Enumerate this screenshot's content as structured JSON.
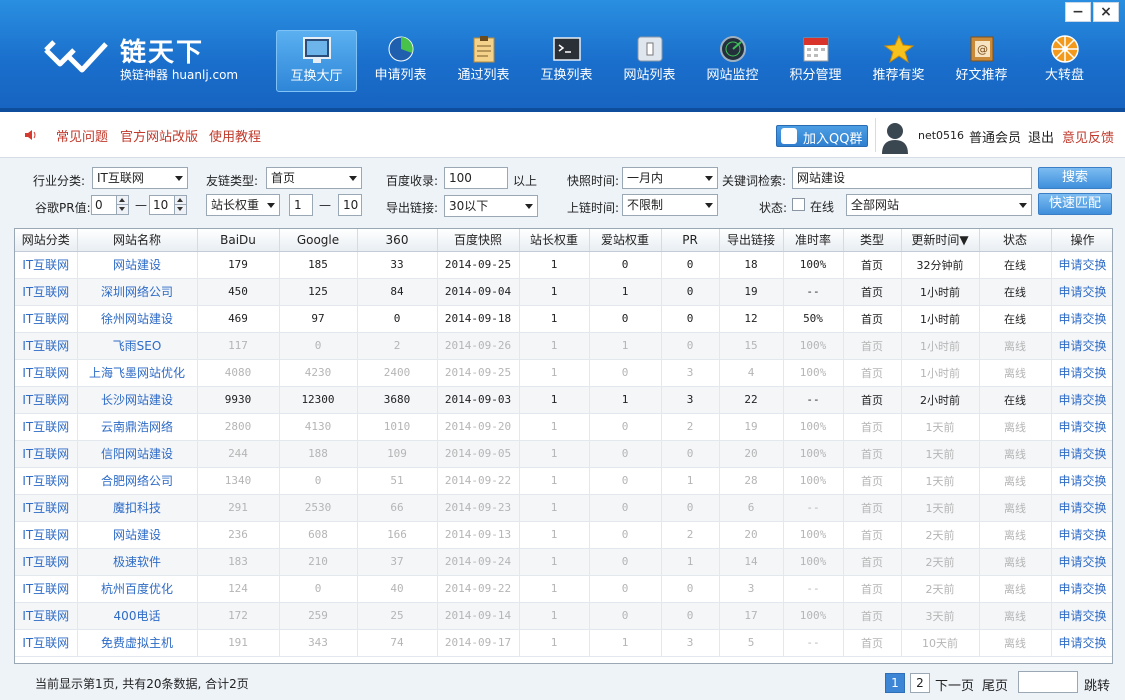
{
  "app": {
    "logo_title": "链天下",
    "logo_sub": "换链神器 huanlj.com"
  },
  "nav": [
    {
      "label": "互换大厅",
      "icon": "monitor-icon",
      "active": true
    },
    {
      "label": "申请列表",
      "icon": "pie-chart-icon"
    },
    {
      "label": "通过列表",
      "icon": "clipboard-icon"
    },
    {
      "label": "互换列表",
      "icon": "console-icon"
    },
    {
      "label": "网站列表",
      "icon": "window-icon"
    },
    {
      "label": "网站监控",
      "icon": "radar-icon"
    },
    {
      "label": "积分管理",
      "icon": "calendar-icon"
    },
    {
      "label": "推荐有奖",
      "icon": "star-icon"
    },
    {
      "label": "好文推荐",
      "icon": "email-book-icon"
    },
    {
      "label": "大转盘",
      "icon": "wheel-icon"
    }
  ],
  "window": {
    "minimize": "−",
    "close": "×"
  },
  "topbar": {
    "links": [
      "常见问题",
      "官方网站改版",
      "使用教程"
    ],
    "qq_button": "加入QQ群",
    "username": "net0516",
    "level": "普通会员",
    "logout": "退出",
    "feedback": "意见反馈"
  },
  "filters": {
    "industry_label": "行业分类:",
    "industry_value": "IT互联网",
    "linktype_label": "友链类型:",
    "linktype_value": "首页",
    "baidu_label": "百度收录:",
    "baidu_value": "100",
    "baidu_suffix": "以上",
    "snapshot_label": "快照时间:",
    "snapshot_value": "一月内",
    "keyword_label": "关键词检索:",
    "keyword_value": "网站建设",
    "search_button": "搜索",
    "pr_label": "谷歌PR值:",
    "pr_min": "0",
    "pr_dash": "—",
    "pr_max": "10",
    "weight_select": "站长权重",
    "weight_min": "1",
    "weight_dash": "—",
    "weight_max": "10",
    "outlink_label": "导出链接:",
    "outlink_value": "30以下",
    "uptime_label": "上链时间:",
    "uptime_value": "不限制",
    "status_label": "状态:",
    "online_label": "在线",
    "site_scope": "全部网站",
    "quick_button": "快速匹配"
  },
  "table": {
    "headers": [
      "网站分类",
      "网站名称",
      "BaiDu",
      "Google",
      "360",
      "百度快照",
      "站长权重",
      "爱站权重",
      "PR",
      "导出链接",
      "准时率",
      "类型",
      "更新时间▼",
      "状态",
      "操作"
    ],
    "rows": [
      {
        "dim": false,
        "cells": [
          "IT互联网",
          "网站建设",
          "179",
          "185",
          "33",
          "2014-09-25",
          "1",
          "0",
          "0",
          "18",
          "100%",
          "首页",
          "32分钟前",
          "在线",
          "申请交换"
        ]
      },
      {
        "dim": false,
        "cells": [
          "IT互联网",
          "深圳网络公司",
          "450",
          "125",
          "84",
          "2014-09-04",
          "1",
          "1",
          "0",
          "19",
          "--",
          "首页",
          "1小时前",
          "在线",
          "申请交换"
        ]
      },
      {
        "dim": false,
        "cells": [
          "IT互联网",
          "徐州网站建设",
          "469",
          "97",
          "0",
          "2014-09-18",
          "1",
          "0",
          "0",
          "12",
          "50%",
          "首页",
          "1小时前",
          "在线",
          "申请交换"
        ]
      },
      {
        "dim": true,
        "cells": [
          "IT互联网",
          "飞雨SEO",
          "117",
          "0",
          "2",
          "2014-09-26",
          "1",
          "1",
          "0",
          "15",
          "100%",
          "首页",
          "1小时前",
          "离线",
          "申请交换"
        ]
      },
      {
        "dim": true,
        "cells": [
          "IT互联网",
          "上海飞墨网站优化",
          "4080",
          "4230",
          "2400",
          "2014-09-25",
          "1",
          "0",
          "3",
          "4",
          "100%",
          "首页",
          "1小时前",
          "离线",
          "申请交换"
        ]
      },
      {
        "dim": false,
        "cells": [
          "IT互联网",
          "长沙网站建设",
          "9930",
          "12300",
          "3680",
          "2014-09-03",
          "1",
          "1",
          "3",
          "22",
          "--",
          "首页",
          "2小时前",
          "在线",
          "申请交换"
        ]
      },
      {
        "dim": true,
        "cells": [
          "IT互联网",
          "云南鼎浩网络",
          "2800",
          "4130",
          "1010",
          "2014-09-20",
          "1",
          "0",
          "2",
          "19",
          "100%",
          "首页",
          "1天前",
          "离线",
          "申请交换"
        ]
      },
      {
        "dim": true,
        "cells": [
          "IT互联网",
          "信阳网站建设",
          "244",
          "188",
          "109",
          "2014-09-05",
          "1",
          "0",
          "0",
          "20",
          "100%",
          "首页",
          "1天前",
          "离线",
          "申请交换"
        ]
      },
      {
        "dim": true,
        "cells": [
          "IT互联网",
          "合肥网络公司",
          "1340",
          "0",
          "51",
          "2014-09-22",
          "1",
          "0",
          "1",
          "28",
          "100%",
          "首页",
          "1天前",
          "离线",
          "申请交换"
        ]
      },
      {
        "dim": true,
        "cells": [
          "IT互联网",
          "魔扣科技",
          "291",
          "2530",
          "66",
          "2014-09-23",
          "1",
          "0",
          "0",
          "6",
          "--",
          "首页",
          "1天前",
          "离线",
          "申请交换"
        ]
      },
      {
        "dim": true,
        "cells": [
          "IT互联网",
          "网站建设",
          "236",
          "608",
          "166",
          "2014-09-13",
          "1",
          "0",
          "2",
          "20",
          "100%",
          "首页",
          "2天前",
          "离线",
          "申请交换"
        ]
      },
      {
        "dim": true,
        "cells": [
          "IT互联网",
          "极速软件",
          "183",
          "210",
          "37",
          "2014-09-24",
          "1",
          "0",
          "1",
          "14",
          "100%",
          "首页",
          "2天前",
          "离线",
          "申请交换"
        ]
      },
      {
        "dim": true,
        "cells": [
          "IT互联网",
          "杭州百度优化",
          "124",
          "0",
          "40",
          "2014-09-22",
          "1",
          "0",
          "0",
          "3",
          "--",
          "首页",
          "2天前",
          "离线",
          "申请交换"
        ]
      },
      {
        "dim": true,
        "cells": [
          "IT互联网",
          "400电话",
          "172",
          "259",
          "25",
          "2014-09-14",
          "1",
          "0",
          "0",
          "17",
          "100%",
          "首页",
          "3天前",
          "离线",
          "申请交换"
        ]
      },
      {
        "dim": true,
        "cells": [
          "IT互联网",
          "免费虚拟主机",
          "191",
          "343",
          "74",
          "2014-09-17",
          "1",
          "1",
          "3",
          "5",
          "--",
          "首页",
          "10天前",
          "离线",
          "申请交换"
        ]
      }
    ]
  },
  "footer": {
    "info": "当前显示第1页, 共有20条数据, 合计2页",
    "pages": [
      "1",
      "2"
    ],
    "next": "下一页",
    "last": "尾页",
    "jump": "跳转"
  }
}
